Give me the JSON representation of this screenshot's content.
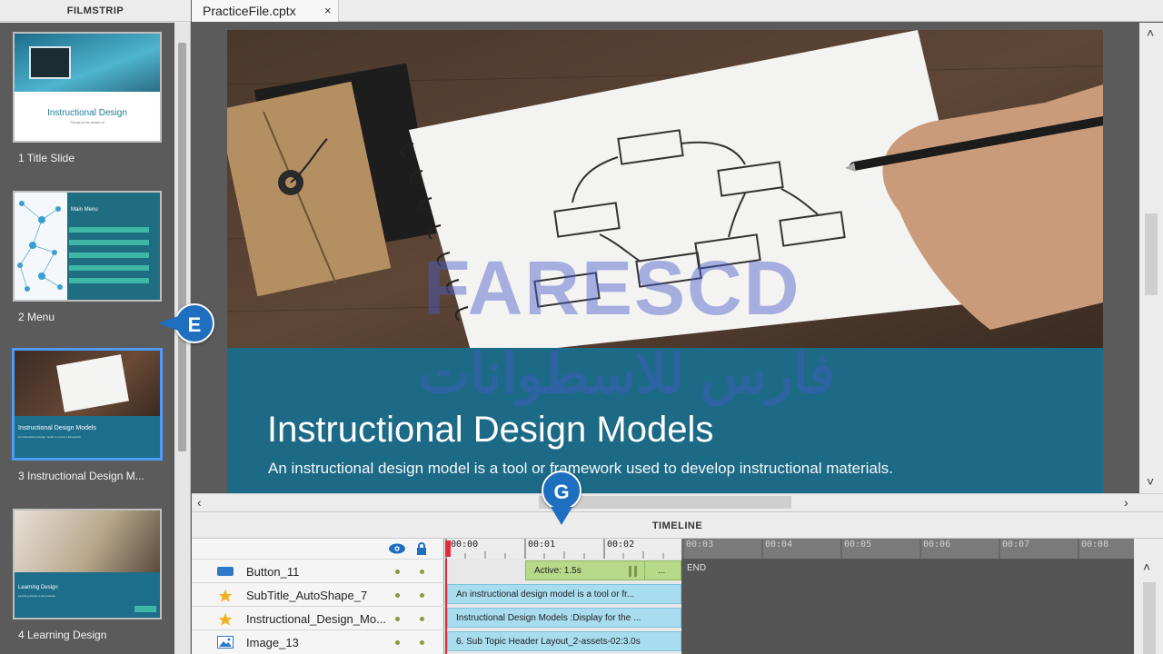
{
  "filmstrip": {
    "header": "FILMSTRIP",
    "slides": [
      {
        "label": "1 Title Slide",
        "thumb_title": "Instructional Design",
        "thumb_sub": "Things to be aware of"
      },
      {
        "label": "2 Menu",
        "thumb_title": "Main Menu"
      },
      {
        "label": "3 Instructional Design M...",
        "thumb_title": "Instructional Design Models",
        "thumb_sub": "An instructional design model is a tool or framework"
      },
      {
        "label": "4 Learning Design",
        "thumb_title": "Learning Design",
        "thumb_sub": "Learning design is the process"
      }
    ]
  },
  "tabs": [
    {
      "label": "PracticeFile.cptx",
      "close": "×"
    }
  ],
  "slide": {
    "title": "Instructional Design Models",
    "subtitle": "An instructional design model is a tool or framework used to develop instructional materials."
  },
  "watermark": {
    "latin": "FARESCD",
    "arabic": "فارس للاسطوانات"
  },
  "timeline": {
    "header": "TIMELINE",
    "ruler": [
      "00:00",
      "00:01",
      "00:02",
      "00:03",
      "00:04",
      "00:05",
      "00:06",
      "00:07",
      "00:08"
    ],
    "end_label": "END",
    "layers": [
      {
        "name": "Button_11",
        "icon": "button-icon",
        "bar": "Active: 1.5s",
        "more": "..."
      },
      {
        "name": "SubTitle_AutoShape_7",
        "icon": "star-icon",
        "bar": "An instructional design model is a tool or fr..."
      },
      {
        "name": "Instructional_Design_Mo...",
        "icon": "star-icon",
        "bar": "Instructional Design Models :Display for the ..."
      },
      {
        "name": "Image_13",
        "icon": "image-icon",
        "bar": "6. Sub Topic Header Layout_2-assets-02:3.0s"
      }
    ]
  },
  "callouts": {
    "e": "E",
    "g": "G"
  },
  "colors": {
    "accent": "#1e6fbf",
    "selection": "#4d9bf5",
    "slide_band": "#1c6a86",
    "bar_blue": "#a8dcef",
    "bar_green": "#b6d98a"
  }
}
